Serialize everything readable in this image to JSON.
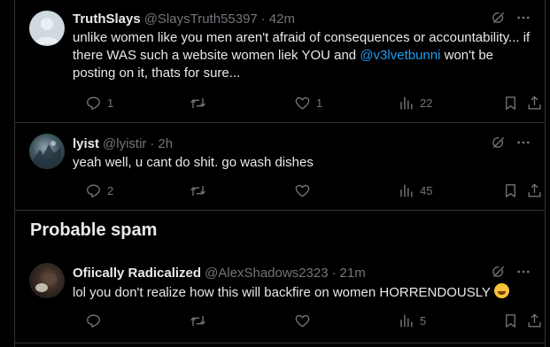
{
  "posts": [
    {
      "name": "TruthSlays",
      "handle": "@SlaysTruth55397",
      "time": "42m",
      "text_parts": [
        "unlike women like you men aren't afraid of consequences or accountability... if there WAS such a website women liek YOU and ",
        "@v3lvetbunni",
        "  won't be posting on it, thats for sure..."
      ],
      "replies": "1",
      "likes": "1",
      "views": "22"
    },
    {
      "name": "lyist",
      "handle": "@lyistir",
      "time": "2h",
      "text": "yeah well, u cant do shit. go wash dishes",
      "replies": "2",
      "views": "45"
    },
    {
      "name": "Ofiically Radicalized",
      "handle": "@AlexShadows2323",
      "time": "21m",
      "text": "lol you don't realize how this will backfire on women HORRENDOUSLY",
      "views": "5"
    }
  ],
  "section_title": "Probable spam",
  "separator": "·",
  "colors": {
    "background": "#000000",
    "text": "#e7e9ea",
    "muted": "#71767b",
    "mention": "#1d9bf0",
    "divider": "#2f3336"
  },
  "icons": [
    "grok-icon",
    "more-icon",
    "reply-icon",
    "retweet-icon",
    "like-icon",
    "views-icon",
    "bookmark-icon",
    "share-icon",
    "rolling-laughing-emoji"
  ]
}
